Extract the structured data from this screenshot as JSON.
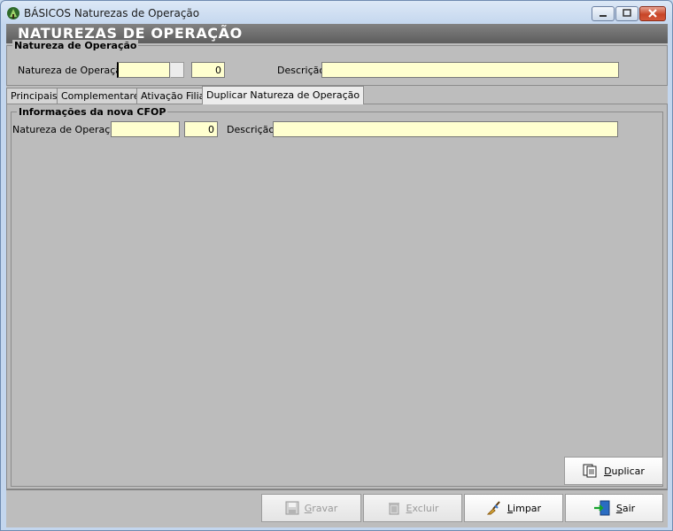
{
  "window": {
    "title": "BÁSICOS Naturezas de Operação"
  },
  "banner": {
    "title": "NATUREZAS DE OPERAÇÃO"
  },
  "top_group": {
    "title": "Natureza de Operação",
    "natureza_label": "Natureza de Operação",
    "natureza_code": "",
    "natureza_number": "0",
    "descricao_label": "Descrição",
    "descricao_value": ""
  },
  "tabs": [
    {
      "label": "Principais"
    },
    {
      "label": "Complementares"
    },
    {
      "label": "Ativação Filial"
    },
    {
      "label": "Duplicar Natureza de Operação"
    }
  ],
  "tab_page": {
    "group_title": "Informações da nova CFOP",
    "natureza_label": "Natureza de Operação",
    "natureza_code": "",
    "natureza_number": "0",
    "descricao_label": "Descrição",
    "descricao_value": "",
    "duplicar_key": "D",
    "duplicar_rest": "uplicar"
  },
  "footer": {
    "gravar_key": "G",
    "gravar_rest": "ravar",
    "excluir_key": "E",
    "excluir_rest": "xcluir",
    "limpar_key": "L",
    "limpar_rest": "impar",
    "sair_key": "S",
    "sair_rest": "air"
  },
  "colors": {
    "field_bg": "#ffffcf",
    "banner_bg": "#6e6e6e",
    "panel_bg": "#bdbdbd"
  }
}
